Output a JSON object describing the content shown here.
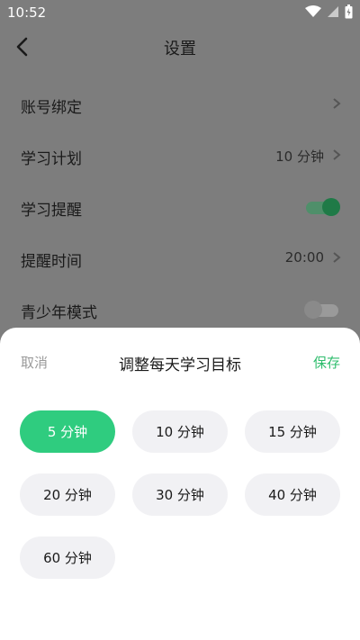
{
  "status_bar": {
    "time": "10:52"
  },
  "header": {
    "title": "设置"
  },
  "rows": [
    {
      "label": "账号绑定",
      "value": "",
      "kind": "nav"
    },
    {
      "label": "学习计划",
      "value": "10 分钟",
      "kind": "nav"
    },
    {
      "label": "学习提醒",
      "value": "",
      "kind": "toggle",
      "on": true
    },
    {
      "label": "提醒时间",
      "value": "20:00",
      "kind": "nav"
    },
    {
      "label": "青少年模式",
      "value": "",
      "kind": "toggle",
      "on": false
    }
  ],
  "sheet": {
    "cancel_label": "取消",
    "title": "调整每天学习目标",
    "save_label": "保存",
    "options": [
      "5 分钟",
      "10 分钟",
      "15 分钟",
      "20 分钟",
      "30 分钟",
      "40 分钟",
      "60 分钟"
    ],
    "selected_index": 0
  },
  "colors": {
    "accent": "#2fcc7f",
    "save_text": "#2fbd6d",
    "overlay_bg": "#7d7d7d",
    "toggle_on_track": "#4f8f6a",
    "toggle_on_knob": "#1f7a47",
    "toggle_off_track": "#9a9a9a",
    "toggle_off_knob": "#8a8a8a"
  }
}
